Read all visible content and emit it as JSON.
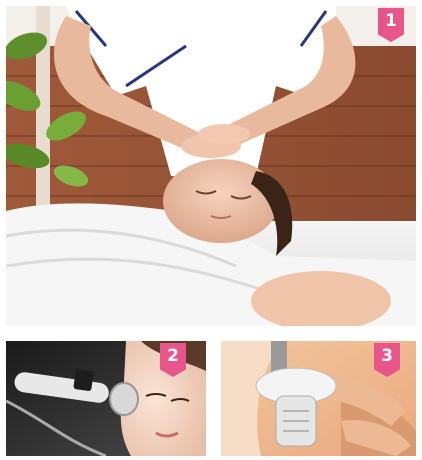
{
  "badges": {
    "one": "1",
    "two": "2",
    "three": "3"
  },
  "colors": {
    "badge": "#e8558a"
  }
}
